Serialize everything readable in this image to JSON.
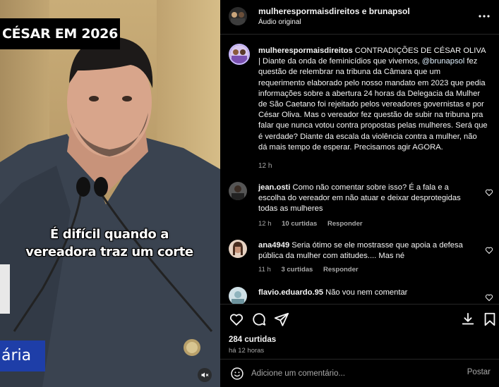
{
  "video": {
    "title_overlay": "CÉSAR EM 2026",
    "subtitle_line1": "É difícil quando a",
    "subtitle_line2": "vereadora traz um corte",
    "lower_third": "ária",
    "mute_icon": "speaker-muted-icon"
  },
  "header": {
    "users": "mulherespormaisdireitos e brunapsol",
    "audio": "Áudio original",
    "more_icon": "more-horizontal-icon"
  },
  "caption": {
    "user": "mulherespormaisdireitos",
    "text_part1": " CONTRADIÇÕES DE CÉSAR OLIVA | Diante da onda de feminicídios que vivemos, ",
    "mention": "@brunapsol",
    "text_part2": " fez questão de relembrar na tribuna da Câmara que um requerimento elaborado pelo nosso mandato em 2023 que pedia informações sobre a abertura 24 horas da Delegacia da Mulher de São Caetano foi rejeitado pelos vereadores governistas e por César Oliva. Mas o vereador fez questão de subir na tribuna pra falar que nunca votou contra propostas pelas mulheres. Será que é verdade? Diante da escala da violência contra a mulher, não dá mais tempo de esperar. Precisamos agir AGORA.",
    "time": "12 h"
  },
  "comments": [
    {
      "user": "jean.osti",
      "text": "Como não comentar sobre isso? É a fala e a escolha do vereador em não atuar e deixar desprotegidas todas as mulheres",
      "time": "12 h",
      "likes": "10 curtidas",
      "reply": "Responder"
    },
    {
      "user": "ana4949",
      "text": "Seria ótimo se ele mostrasse que apoia a defesa pública da mulher com atitudes.... Mas né",
      "time": "11 h",
      "likes": "3 curtidas",
      "reply": "Responder"
    },
    {
      "user": "flavio.eduardo.95",
      "text": "Não vou nem comentar",
      "time": "",
      "likes": "",
      "reply": ""
    }
  ],
  "actions": {
    "like_icon": "heart-icon",
    "comment_icon": "comment-bubble-icon",
    "share_icon": "paper-plane-icon",
    "download_icon": "download-icon",
    "save_icon": "bookmark-icon",
    "likes_count": "284 curtidas",
    "posted_ago": "há 12 horas"
  },
  "composer": {
    "placeholder": "Adicione um comentário...",
    "post_label": "Postar",
    "emoji_icon": "smiley-icon"
  }
}
